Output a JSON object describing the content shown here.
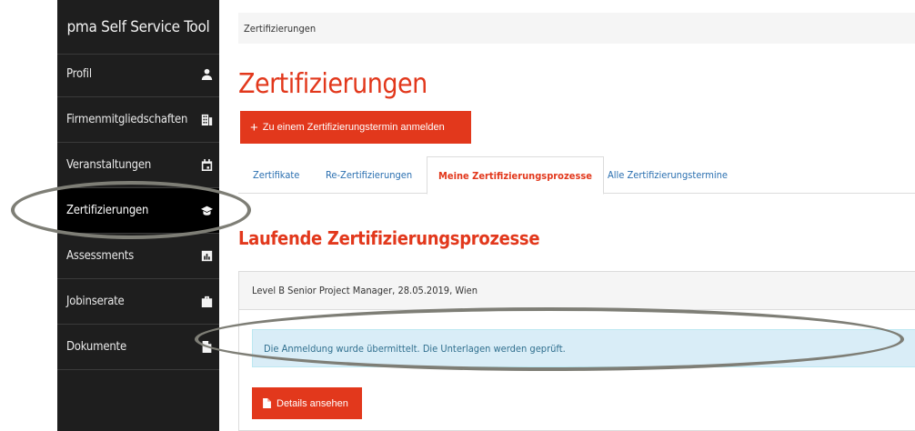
{
  "sidebar": {
    "title": "pma Self Service Tool",
    "items": [
      {
        "label": "Profil",
        "icon": "user-icon"
      },
      {
        "label": "Firmenmitgliedschaften",
        "icon": "building-icon"
      },
      {
        "label": "Veranstaltungen",
        "icon": "calendar-icon"
      },
      {
        "label": "Zertifizierungen",
        "icon": "graduation-cap-icon",
        "active": true
      },
      {
        "label": "Assessments",
        "icon": "bar-chart-icon"
      },
      {
        "label": "Jobinserate",
        "icon": "briefcase-icon"
      },
      {
        "label": "Dokumente",
        "icon": "document-icon"
      }
    ]
  },
  "breadcrumb": "Zertifizierungen",
  "page_title": "Zertifizierungen",
  "register_button": {
    "plus": "+",
    "label": "Zu einem Zertifizierungstermin anmelden"
  },
  "tabs": [
    {
      "label": "Zertifikate"
    },
    {
      "label": "Re-Zertifizierungen"
    },
    {
      "label": "Meine Zertifizierungsprozesse",
      "active": true
    },
    {
      "label": "Alle Zertifizierungstermine"
    }
  ],
  "section_title": "Laufende Zertifizierungsprozesse",
  "process": {
    "header": "Level B Senior Project Manager, 28.05.2019, Wien",
    "alert": "Die Anmeldung wurde übermittelt. Die Unterlagen werden geprüft.",
    "details_button": "Details ansehen"
  },
  "colors": {
    "accent": "#e2381c",
    "sidebar_bg": "#1e1e1e",
    "alert_bg": "#d9edf7",
    "link": "#2a6fb0",
    "annotation": "#7e7e76"
  }
}
